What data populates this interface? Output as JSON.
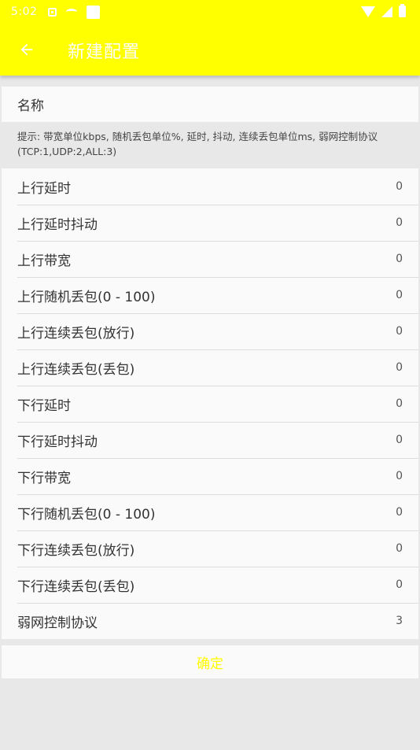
{
  "status_bar": {
    "time": "5:02"
  },
  "app_bar": {
    "title": "新建配置"
  },
  "name_field": {
    "label": "名称"
  },
  "hint": {
    "text": "提示: 带宽单位kbps, 随机丢包单位%, 延时, 抖动, 连续丢包单位ms, 弱网控制协议(TCP:1,UDP:2,ALL:3)"
  },
  "settings": [
    {
      "label": "上行延时",
      "value": "0"
    },
    {
      "label": "上行延时抖动",
      "value": "0"
    },
    {
      "label": "上行带宽",
      "value": "0"
    },
    {
      "label": "上行随机丢包(0 - 100)",
      "value": "0"
    },
    {
      "label": "上行连续丢包(放行)",
      "value": "0"
    },
    {
      "label": "上行连续丢包(丢包)",
      "value": "0"
    },
    {
      "label": "下行延时",
      "value": "0"
    },
    {
      "label": "下行延时抖动",
      "value": "0"
    },
    {
      "label": "下行带宽",
      "value": "0"
    },
    {
      "label": "下行随机丢包(0 - 100)",
      "value": "0"
    },
    {
      "label": "下行连续丢包(放行)",
      "value": "0"
    },
    {
      "label": "下行连续丢包(丢包)",
      "value": "0"
    },
    {
      "label": "弱网控制协议",
      "value": "3"
    }
  ],
  "confirm_button": {
    "label": "确定"
  },
  "colors": {
    "accent": "#ffff00",
    "list_bg": "#fafafa",
    "page_bg": "#e8e8e8"
  }
}
